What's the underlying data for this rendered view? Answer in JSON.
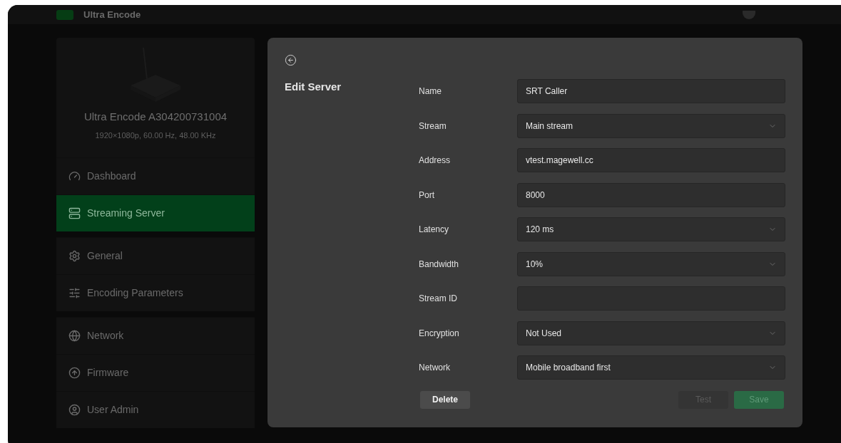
{
  "header": {
    "title": "Ultra Encode"
  },
  "device": {
    "name": "Ultra Encode A304200731004",
    "signal": "1920×1080p, 60.00 Hz, 48.00 KHz"
  },
  "sidebar": {
    "groups": [
      {
        "items": [
          {
            "label": "Dashboard",
            "selected": false
          },
          {
            "label": "Streaming Server",
            "selected": true
          }
        ]
      },
      {
        "items": [
          {
            "label": "General",
            "selected": false
          },
          {
            "label": "Encoding Parameters",
            "selected": false
          }
        ]
      },
      {
        "items": [
          {
            "label": "Network",
            "selected": false
          },
          {
            "label": "Firmware",
            "selected": false
          },
          {
            "label": "User Admin",
            "selected": false
          }
        ]
      }
    ]
  },
  "dialog": {
    "title": "Edit Server",
    "fields": [
      {
        "label": "Name",
        "kind": "text",
        "value": "SRT Caller"
      },
      {
        "label": "Stream",
        "kind": "select",
        "value": "Main stream"
      },
      {
        "label": "Address",
        "kind": "text",
        "value": "vtest.magewell.cc"
      },
      {
        "label": "Port",
        "kind": "text",
        "value": "8000"
      },
      {
        "label": "Latency",
        "kind": "select",
        "value": "120 ms"
      },
      {
        "label": "Bandwidth",
        "kind": "select",
        "value": "10%"
      },
      {
        "label": "Stream ID",
        "kind": "text"
      },
      {
        "label": "Encryption",
        "kind": "select",
        "value": "Not Used"
      },
      {
        "label": "Network",
        "kind": "select",
        "value": "Mobile broadband first"
      }
    ],
    "buttons": [
      {
        "label": "Delete",
        "kind": "neutral",
        "disabled": false
      },
      {
        "label": "Test",
        "kind": "neutral",
        "disabled": true
      },
      {
        "label": "Save",
        "kind": "primary",
        "disabled": true
      }
    ]
  }
}
